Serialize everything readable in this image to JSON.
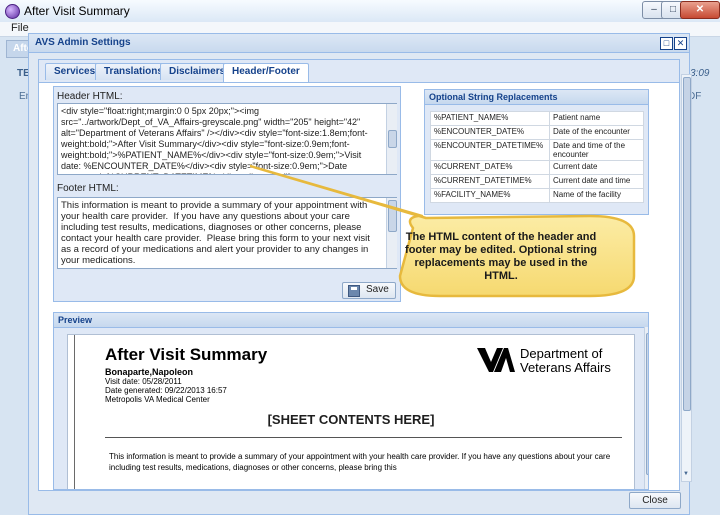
{
  "window": {
    "title": "After Visit Summary",
    "minimize": "–",
    "maximize": "□",
    "close": "✕"
  },
  "menu": {
    "file": "File"
  },
  "background": {
    "tab_stub": "Afte",
    "left_label": "TES",
    "left_sub": "Enc",
    "right_label": "3:09",
    "right_sub": "DF"
  },
  "modal": {
    "title": "AVS Admin Settings",
    "tabs": [
      {
        "label": "Services"
      },
      {
        "label": "Translations"
      },
      {
        "label": "Disclaimers"
      },
      {
        "label": "Header/Footer"
      }
    ],
    "active_tab": "Header/Footer",
    "header_label": "Header HTML:",
    "header_value": "<div style=\"float:right;margin:0 0 5px 20px;\"><img src=\"../artwork/Dept_of_VA_Affairs-greyscale.png\" width=\"205\" height=\"42\" alt=\"Department of Veterans Affairs\" /></div><div style=\"font-size:1.8em;font-weight:bold;\">After Visit Summary</div><div style=\"font-size:0.9em;font-weight:bold;\">%PATIENT_NAME%</div><div style=\"font-size:0.9em;\">Visit date: %ENCOUNTER_DATE%</div><div style=\"font-size:0.9em;\">Date generated: %CURRENT_DATETIME%</div><div style=\"font-size:0.9em;\">%FACILITY_NAME%",
    "footer_label": "Footer HTML:",
    "footer_value": "This information is meant to provide a summary of your appointment with your health care provider.  If you have any questions about your care including test results, medications, diagnoses or other concerns, please contact your health care provider.  Please bring this form to your next visit as a record of your medications and alert your provider to any changes in your medications.\n\n<hr/><hr/>",
    "save_label": "Save",
    "optional": {
      "title": "Optional String Replacements",
      "rows": [
        {
          "key": "%PATIENT_NAME%",
          "desc": "Patient name"
        },
        {
          "key": "%ENCOUNTER_DATE%",
          "desc": "Date of the encounter"
        },
        {
          "key": "%ENCOUNTER_DATETIME%",
          "desc": "Date and time of the encounter"
        },
        {
          "key": "%CURRENT_DATE%",
          "desc": "Current date"
        },
        {
          "key": "%CURRENT_DATETIME%",
          "desc": "Current date and time"
        },
        {
          "key": "%FACILITY_NAME%",
          "desc": "Name of the facility"
        }
      ]
    },
    "callout": "The HTML content of the header and footer may be edited. Optional string replacements may be used in the HTML.",
    "preview": {
      "title": "Preview",
      "doc_title": "After Visit Summary",
      "patient": "Bonaparte,Napoleon",
      "visit_date": "Visit date: 05/28/2011",
      "generated": "Date generated: 09/22/2013 16:57",
      "facility": "Metropolis VA Medical Center",
      "va_line1": "Department of",
      "va_line2": "Veterans Affairs",
      "sheet": "[SHEET CONTENTS HERE]",
      "footer_text": "This information is meant to provide a summary of your appointment with your health care provider. If you have any questions about your care including test results, medications, diagnoses or other concerns, please bring this"
    },
    "close_label": "Close"
  }
}
